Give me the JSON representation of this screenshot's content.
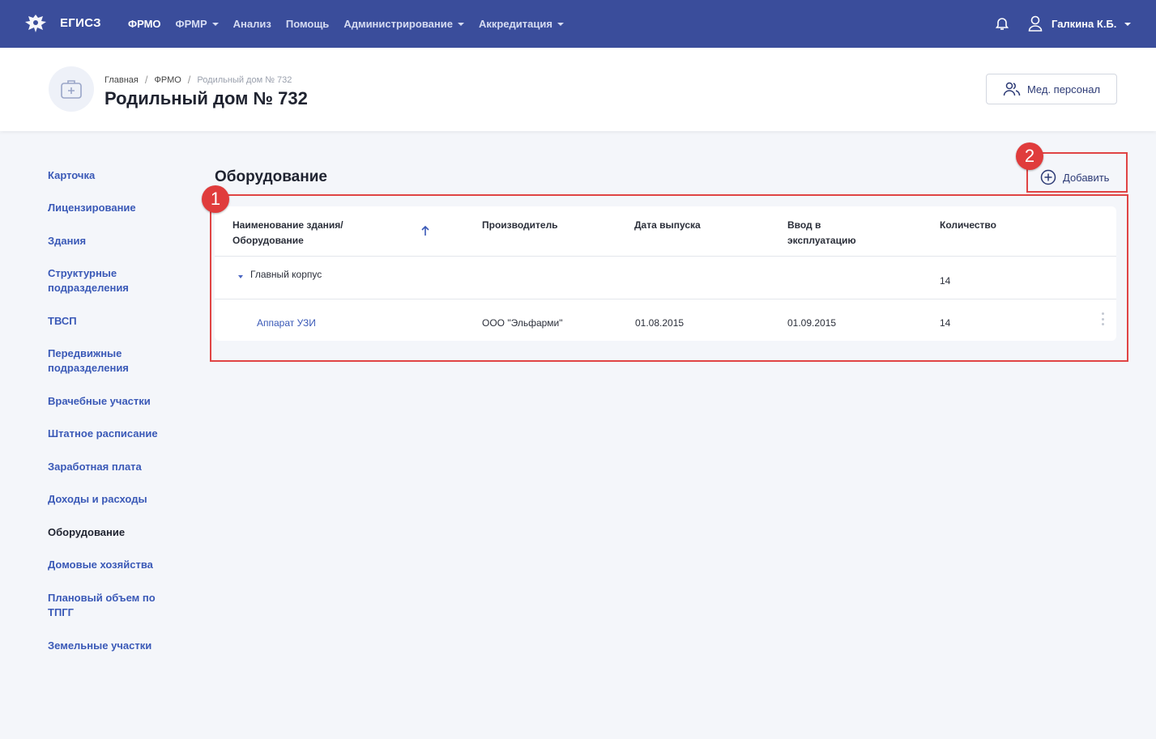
{
  "app": {
    "brand": "ЕГИСЗ"
  },
  "nav": {
    "items": [
      {
        "label": "ФРМО",
        "active": true,
        "dropdown": false
      },
      {
        "label": "ФРМР",
        "active": false,
        "dropdown": true
      },
      {
        "label": "Анализ",
        "active": false,
        "dropdown": false
      },
      {
        "label": "Помощь",
        "active": false,
        "dropdown": false
      },
      {
        "label": "Администрирование",
        "active": false,
        "dropdown": true
      },
      {
        "label": "Аккредитация",
        "active": false,
        "dropdown": true
      }
    ],
    "user_name": "Галкина К.Б."
  },
  "header": {
    "breadcrumb": [
      "Главная",
      "ФРМО",
      "Родильный дом № 732"
    ],
    "title": "Родильный дом № 732",
    "staff_button": "Мед. персонал"
  },
  "sidebar": {
    "items": [
      {
        "label": "Карточка",
        "active": false
      },
      {
        "label": "Лицензирование",
        "active": false
      },
      {
        "label": "Здания",
        "active": false
      },
      {
        "label": "Структурные подразделения",
        "active": false
      },
      {
        "label": "ТВСП",
        "active": false
      },
      {
        "label": "Передвижные подразделения",
        "active": false
      },
      {
        "label": "Врачебные участки",
        "active": false
      },
      {
        "label": "Штатное расписание",
        "active": false
      },
      {
        "label": "Заработная плата",
        "active": false
      },
      {
        "label": "Доходы и расходы",
        "active": false
      },
      {
        "label": "Оборудование",
        "active": true
      },
      {
        "label": "Домовые хозяйства",
        "active": false
      },
      {
        "label": "Плановый объем по ТПГГ",
        "active": false
      },
      {
        "label": "Земельные участки",
        "active": false
      }
    ]
  },
  "main": {
    "title": "Оборудование",
    "add_button": "Добавить",
    "columns": [
      "Наименование здания/ Оборудование",
      "Производитель",
      "Дата выпуска",
      "Ввод в эксплуатацию",
      "Количество"
    ],
    "group_row": {
      "name": "Главный корпус",
      "quantity": "14"
    },
    "item_row": {
      "name": "Аппарат УЗИ",
      "manufacturer": "ООО \"Эльфарми\"",
      "release_date": "01.08.2015",
      "commissioning_date": "01.09.2015",
      "quantity": "14"
    }
  },
  "annotations": {
    "marker_1": "1",
    "marker_2": "2"
  },
  "colors": {
    "nav_bg": "#3a4d9b",
    "link": "#3a59b7",
    "annotation": "#e04444"
  }
}
